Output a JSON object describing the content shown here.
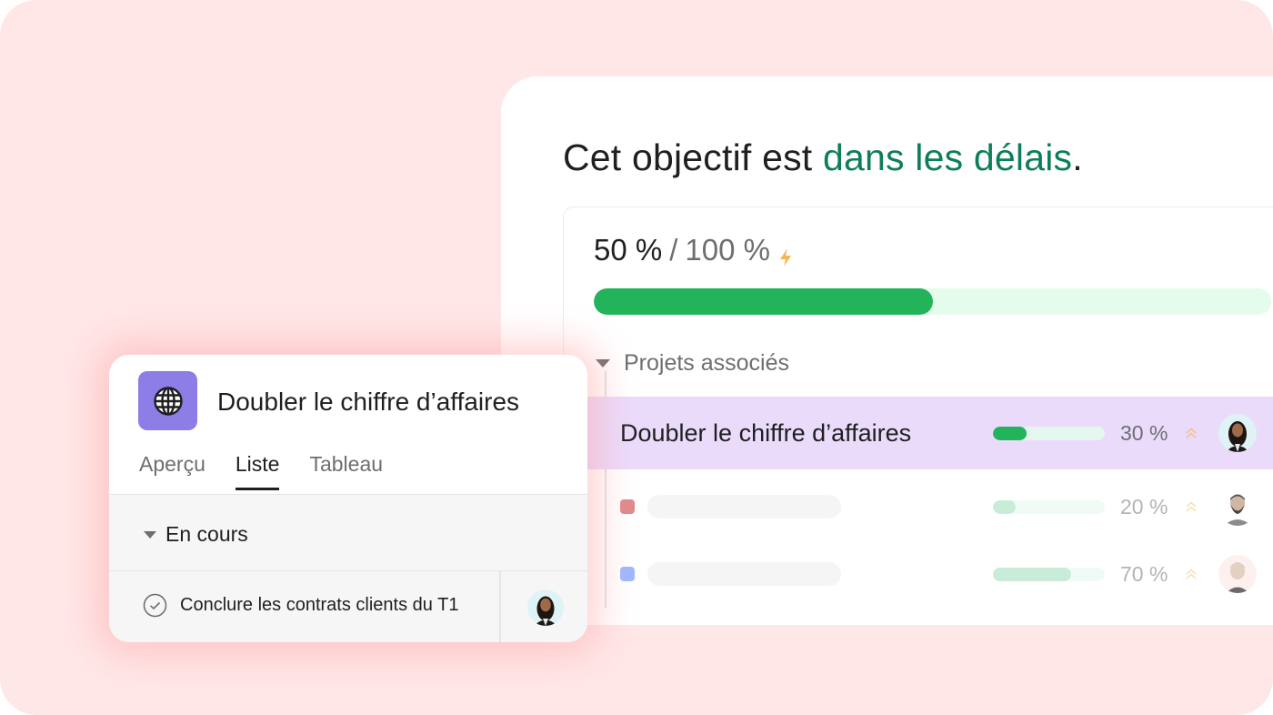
{
  "goal": {
    "headline_prefix": "Cet objectif est ",
    "headline_status": "dans les délais",
    "headline_suffix": ".",
    "status_color": "#0d7f56",
    "progress_current": "50 %",
    "progress_separator": "/",
    "progress_target": "100 %",
    "progress_fraction": 0.5,
    "progress_icon": "lightning-bolt-icon"
  },
  "related_projects": {
    "section_label": "Projets associés",
    "items": [
      {
        "name": "Doubler le chiffre d’affaires",
        "percent_label": "30 %",
        "progress": 0.3,
        "priority_icon": "double-chevron-up-icon",
        "avatar": "woman-dark-hair",
        "highlighted": true
      },
      {
        "name": "",
        "color": "#e08a8c",
        "percent_label": "20 %",
        "progress": 0.2,
        "priority_icon": "double-chevron-up-icon",
        "avatar": "man-beard",
        "highlighted": false
      },
      {
        "name": "",
        "color": "#9fb8ff",
        "percent_label": "70 %",
        "progress": 0.7,
        "priority_icon": "double-chevron-up-icon",
        "avatar": "woman-blonde",
        "highlighted": false
      }
    ]
  },
  "project_card": {
    "icon": "globe-icon",
    "icon_color": "#8c7ee6",
    "title": "Doubler le chiffre d’affaires",
    "tabs": [
      {
        "label": "Aperçu",
        "active": false
      },
      {
        "label": "Liste",
        "active": true
      },
      {
        "label": "Tableau",
        "active": false
      }
    ],
    "group_label": "En cours",
    "tasks": [
      {
        "name": "Conclure les contrats clients du T1",
        "completed_icon": "check-circle-icon",
        "assignee_avatar": "woman-dark-hair"
      }
    ]
  }
}
